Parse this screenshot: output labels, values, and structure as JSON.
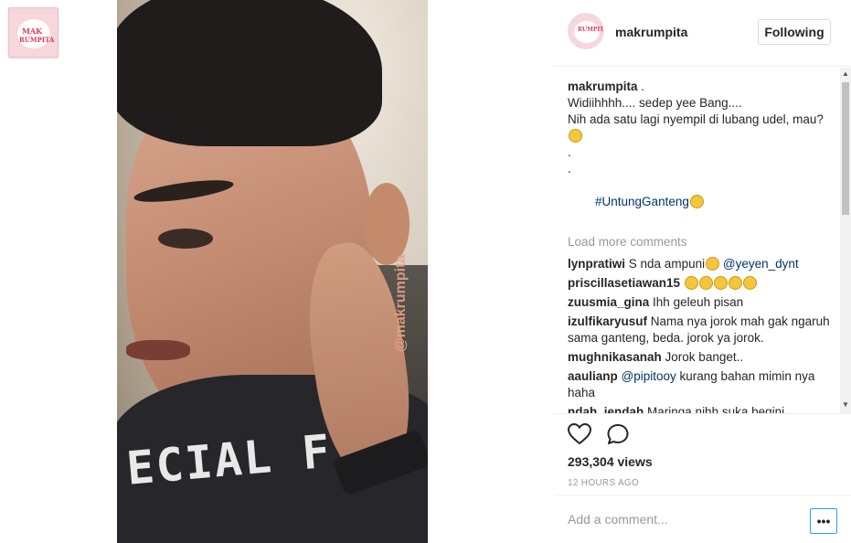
{
  "logo": {
    "line1": "MAK",
    "line2": "RUMPITA"
  },
  "video": {
    "watermark": "@makrumpita",
    "shirt_text": "ECIAL FIEL"
  },
  "header": {
    "username": "makrumpita",
    "follow_label": "Following"
  },
  "caption": {
    "user": "makrumpita",
    "suffix": " .",
    "lines": [
      "Widiihhhh.... sedep yee Bang....",
      "Nih ada satu lagi nyempil di lubang udel, mau?"
    ],
    "dot1": ".",
    "dot2": ".",
    "hashtag": "#UntungGanteng"
  },
  "load_more": "Load more comments",
  "comments": [
    {
      "user": "lynpratiwi",
      "text": "S nda ampuni",
      "mention": "@yeyen_dynt",
      "after": ""
    },
    {
      "user": "priscillasetiawan15",
      "text": "",
      "mention": "",
      "after": ""
    },
    {
      "user": "zuusmia_gina",
      "text": "Ihh geleuh pisan",
      "mention": "",
      "after": ""
    },
    {
      "user": "izulfikaryusuf",
      "text": "Nama nya jorok mah gak ngaruh sama ganteng, beda. jorok ya jorok.",
      "mention": "",
      "after": ""
    },
    {
      "user": "mughnikasanah",
      "text": "Jorok banget..",
      "mention": "",
      "after": ""
    },
    {
      "user": "aaulianp",
      "text": "",
      "mention": "@pipitooy",
      "after": " kurang bahan mimin nya haha"
    },
    {
      "user": "ndah_jendah",
      "text": "Maringa nihh suka begini",
      "mention": "",
      "after": ""
    }
  ],
  "stats": {
    "views": "293,304 views",
    "timestamp": "12 HOURS AGO"
  },
  "add_comment": {
    "placeholder": "Add a comment...",
    "more_label": "•••"
  },
  "icons": {
    "heart": "heart-icon",
    "comment": "comment-icon"
  },
  "colors": {
    "link": "#003569",
    "muted": "#999999",
    "accent": "#3897f0"
  }
}
